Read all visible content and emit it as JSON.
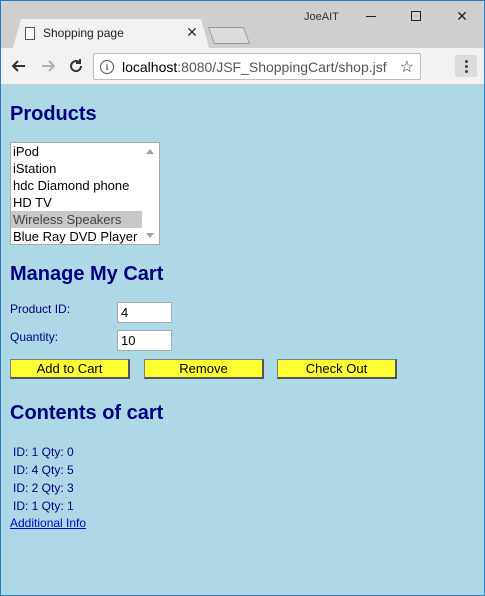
{
  "browser": {
    "tab_title": "Shopping page",
    "profile_name": "JoeAIT",
    "url_host": "localhost",
    "url_path": ":8080/JSF_ShoppingCart/shop.jsf"
  },
  "products": {
    "heading": "Products",
    "items": [
      "iPod",
      "iStation",
      "hdc Diamond phone",
      "HD TV",
      "Wireless Speakers",
      "Blue Ray DVD Player"
    ],
    "selected": "Wireless Speakers"
  },
  "manage": {
    "heading": "Manage My Cart",
    "product_id_label": "Product ID:",
    "product_id_value": "4",
    "quantity_label": "Quantity:",
    "quantity_value": "10",
    "add_label": "Add to Cart",
    "remove_label": "Remove",
    "checkout_label": "Check Out"
  },
  "cart": {
    "heading": "Contents of cart",
    "lines": [
      "ID: 1  Qty: 0",
      "ID: 4  Qty: 5",
      "ID: 2  Qty: 3",
      "ID: 1  Qty: 1"
    ],
    "link_label": "Additional Info"
  },
  "colors": {
    "page_bg": "#add8e6",
    "heading": "#000080",
    "button_bg": "#ffff33",
    "link": "#0000cc"
  }
}
